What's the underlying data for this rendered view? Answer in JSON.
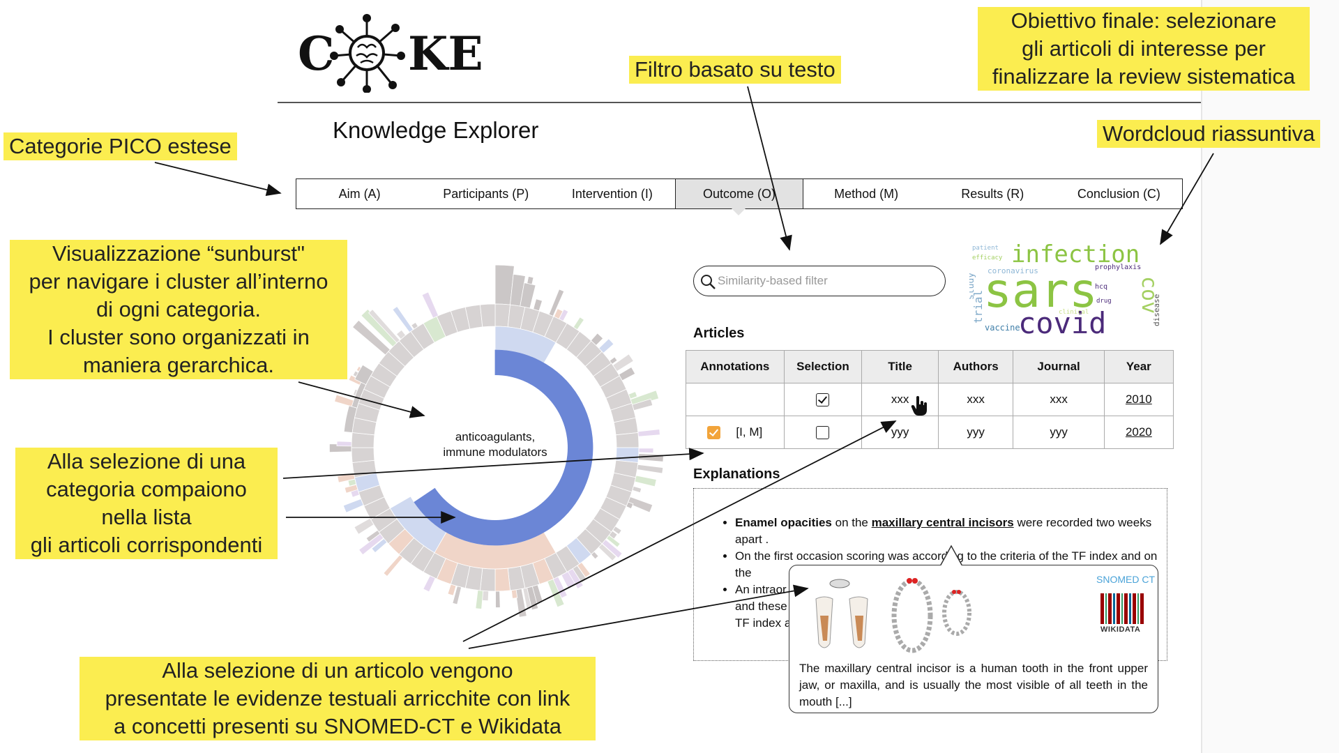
{
  "app": {
    "logo_left": "C",
    "logo_right": "KE",
    "title": "Knowledge Explorer"
  },
  "tabs": [
    {
      "label": "Aim (A)",
      "active": false
    },
    {
      "label": "Participants (P)",
      "active": false
    },
    {
      "label": "Intervention (I)",
      "active": false
    },
    {
      "label": "Outcome (O)",
      "active": true
    },
    {
      "label": "Method (M)",
      "active": false
    },
    {
      "label": "Results (R)",
      "active": false
    },
    {
      "label": "Conclusion (C)",
      "active": false
    }
  ],
  "sunburst": {
    "center_label_line1": "anticoagulants,",
    "center_label_line2": "immune modulators",
    "highlight_color": "#6b86d6",
    "ring_color": "#d3d0d0"
  },
  "search": {
    "placeholder": "Similarity-based filter"
  },
  "wordcloud": {
    "words": [
      "infection",
      "sars",
      "covid",
      "cov",
      "trial",
      "study",
      "vaccine",
      "disease",
      "coronavirus",
      "patient",
      "prophylaxis",
      "efficacy",
      "hcq",
      "drug",
      "clinical"
    ]
  },
  "articles": {
    "heading": "Articles",
    "columns": [
      "Annotations",
      "Selection",
      "Title",
      "Authors",
      "Journal",
      "Year"
    ],
    "rows": [
      {
        "annotations": "",
        "annotated": false,
        "selected": true,
        "title": "xxx",
        "authors": "xxx",
        "journal": "xxx",
        "year": "2010"
      },
      {
        "annotations": "[I, M]",
        "annotated": true,
        "selected": false,
        "title": "yyy",
        "authors": "yyy",
        "journal": "yyy",
        "year": "2020"
      }
    ]
  },
  "explanations": {
    "heading": "Explanations",
    "item1_bold": "Enamel opacities",
    "item1_mid": " on the ",
    "item1_link": "maxillary central incisors",
    "item1_rest": " were recorded two weeks apart .",
    "item2": "On the first occasion scoring was according to the criteria of the TF index and on the",
    "item3_a": "An intraor",
    "item3_b": "and these",
    "item3_c": "TF index a"
  },
  "popup": {
    "snomed_label": "SNOMED CT",
    "wikidata_label": "WIKIDATA",
    "description": "The maxillary central incisor is a human tooth in the front upper jaw, or maxilla, and is usually the most visible of all teeth in the mouth [...]"
  },
  "callouts": {
    "pico": "Categorie PICO estese",
    "filter": "Filtro basato su testo",
    "goal_l1": "Obiettivo finale: selezionare",
    "goal_l2": "gli articoli di interesse per",
    "goal_l3": "finalizzare la review sistematica",
    "wordcloud": "Wordcloud riassuntiva",
    "sunburst_l1": "Visualizzazione “sunburst\"",
    "sunburst_l2": "per navigare i cluster all’interno",
    "sunburst_l3": "di ogni categoria.",
    "sunburst_l4": "I cluster sono organizzati in",
    "sunburst_l5": "maniera gerarchica.",
    "category_l1": "Alla selezione di una",
    "category_l2": "categoria compaiono",
    "category_l3": "nella lista",
    "category_l4": "gli articoli corrispondenti",
    "article_l1": "Alla selezione di un articolo vengono",
    "article_l2": "presentate le evidenze testuali arricchite con link",
    "article_l3": "a concetti presenti su SNOMED-CT e Wikidata"
  },
  "colors": {
    "callout": "#fbed50",
    "annotation_check": "#f2a43a",
    "active_tab": "#e2e2e2"
  }
}
